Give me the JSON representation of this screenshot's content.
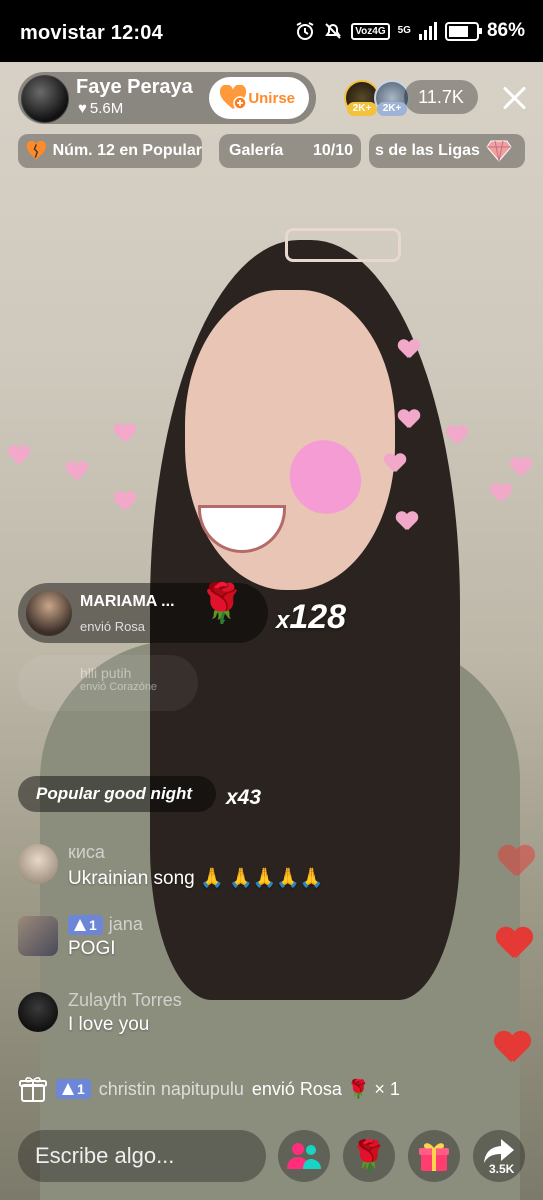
{
  "status_bar": {
    "carrier": "movistar",
    "time": "12:04",
    "network_label": "Voz4G",
    "network_type": "5G",
    "battery": "86%",
    "battery_level": 0.86,
    "icons": [
      "alarm-icon",
      "mute-icon",
      "signal-icon",
      "battery-saver-icon"
    ]
  },
  "header": {
    "host_name": "Faye Peraya",
    "host_likes": "5.6M",
    "join_label": "Unirse",
    "viewer_badges": [
      "2K+",
      "2K+"
    ],
    "viewer_count": "11.7K"
  },
  "chips": {
    "rank": "Núm. 12 en Popular",
    "gallery_label": "Galería",
    "gallery_progress": "10/10",
    "leagues": "s de las Ligas"
  },
  "gift_popup": {
    "sender": "MARIAMA ...",
    "action": "envió Rosa",
    "combo": "x128"
  },
  "faded_popup": {
    "line1": "hlli putih",
    "line2": "envió Corazóne"
  },
  "popular_banner": {
    "prefix": "Popular",
    "text": "good night",
    "combo": "x43"
  },
  "chat": [
    {
      "user": "киса",
      "level": "",
      "text": "Ukrainian song 🙏 🙏🙏🙏🙏",
      "avatar_color": "#c8b8a8"
    },
    {
      "user": "jana",
      "level": "1",
      "text": "POGI",
      "avatar_color": "#8a7a6a"
    },
    {
      "user": "Zulayth Torres",
      "level": "",
      "text": "I love you",
      "avatar_color": "#1a1a1a"
    }
  ],
  "gift_notice": {
    "level": "1",
    "user": "christin napitupulu",
    "action": "envió Rosa 🌹 × 1"
  },
  "bottom_bar": {
    "input_placeholder": "Escribe algo...",
    "share_count": "3.5K"
  },
  "colors": {
    "accent_orange": "#ff8a2a",
    "level_blue": "#6d86d8",
    "heart_red": "#e53935"
  }
}
